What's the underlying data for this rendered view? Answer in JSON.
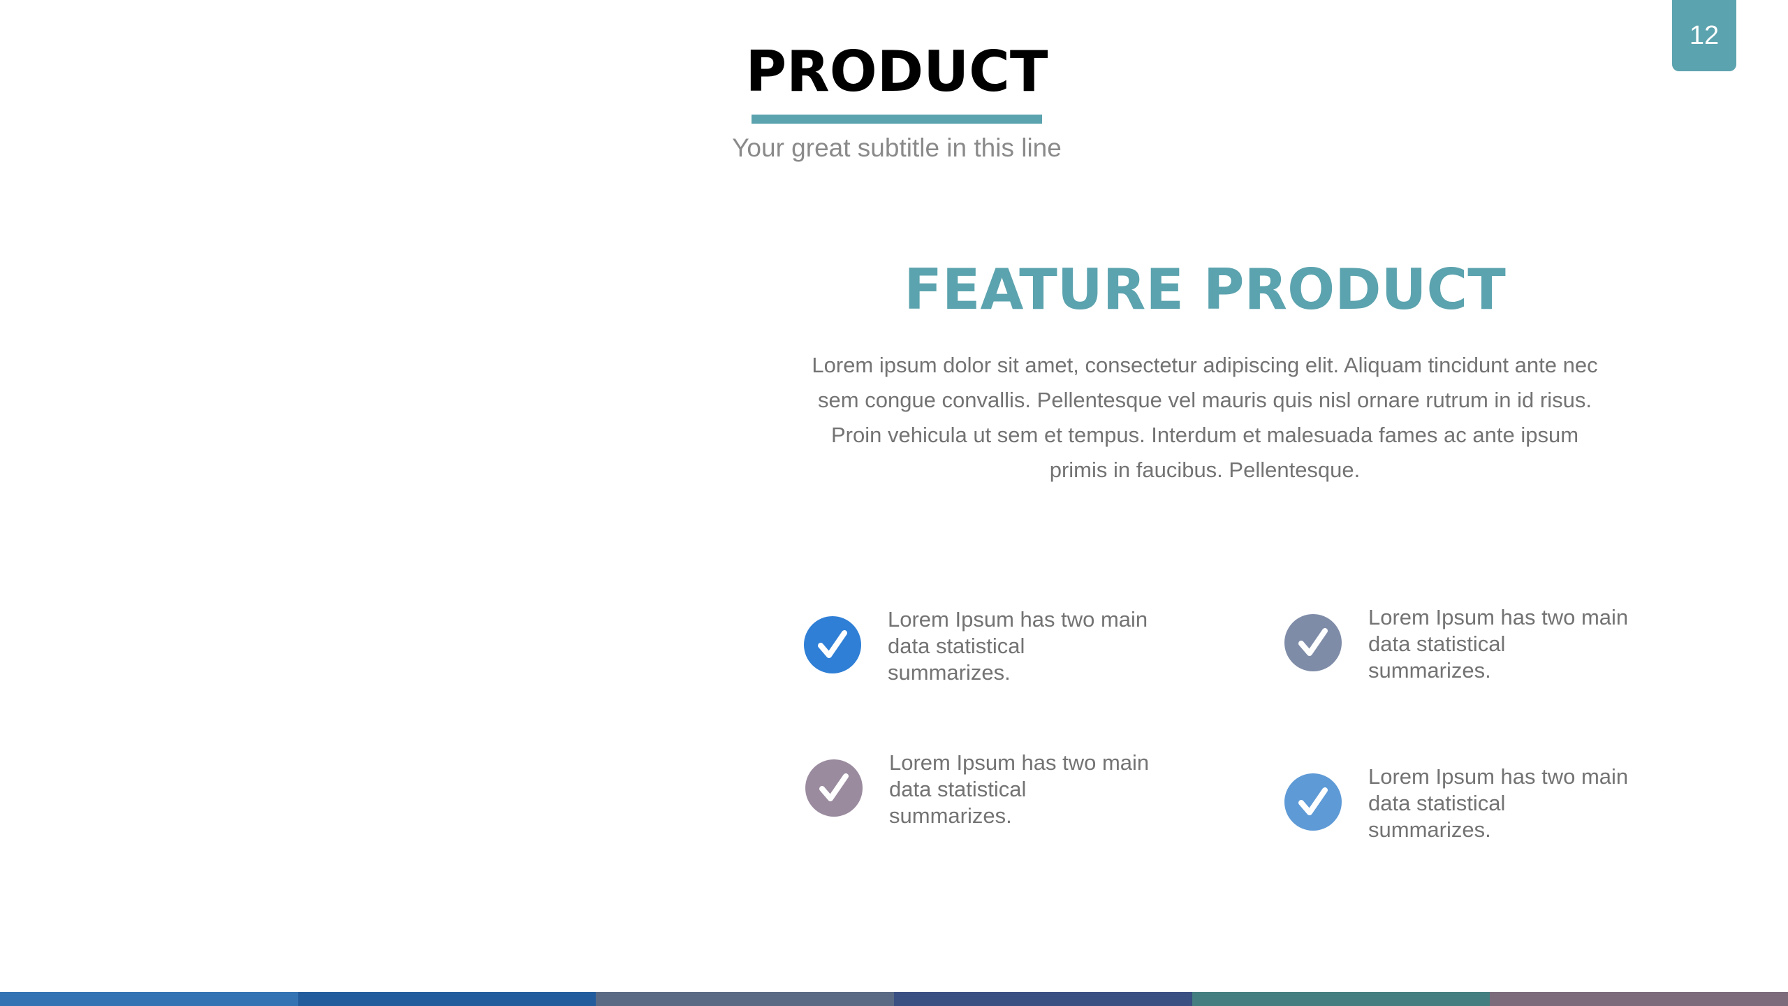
{
  "page_number": "12",
  "header": {
    "title": "PRODUCT",
    "subtitle": "Your great subtitle in this line"
  },
  "feature": {
    "title": "FEATURE PRODUCT",
    "body": "Lorem ipsum dolor sit amet, consectetur adipiscing elit. Aliquam tincidunt ante nec sem congue convallis. Pellentesque vel mauris quis nisl ornare rutrum in id risus. Proin vehicula ut sem et tempus. Interdum et malesuada fames ac ante ipsum primis in faucibus. Pellentesque."
  },
  "checklist": [
    {
      "text": "Lorem Ipsum has two main data statistical summarizes.",
      "icon": "check-circle-icon",
      "color": "#2f7fd6"
    },
    {
      "text": "Lorem Ipsum has two main data statistical summarizes.",
      "icon": "check-circle-icon",
      "color": "#7f8ca8"
    },
    {
      "text": "Lorem Ipsum has two main data statistical summarizes.",
      "icon": "check-circle-icon",
      "color": "#9b8b9f"
    },
    {
      "text": "Lorem Ipsum has two main data statistical summarizes.",
      "icon": "check-circle-icon",
      "color": "#5e9ad6"
    }
  ],
  "colors": {
    "accent": "#5ba3ae",
    "footer_bar": [
      "#3373b3",
      "#235c9c",
      "#5a6a85",
      "#3a4f82",
      "#447e80",
      "#7b6b7b"
    ]
  }
}
